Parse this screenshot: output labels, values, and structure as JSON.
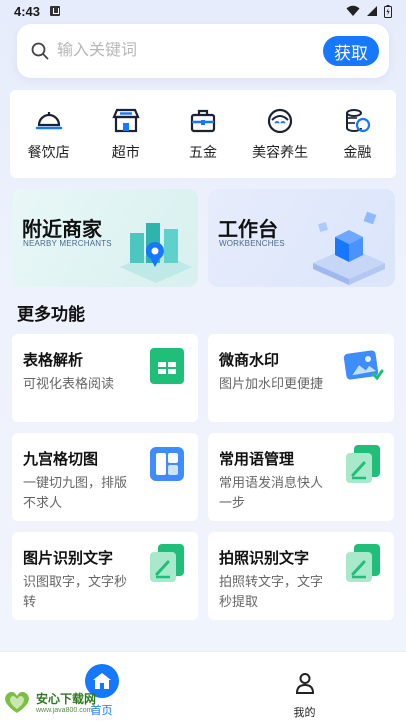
{
  "status_bar": {
    "time": "4:43"
  },
  "search": {
    "placeholder": "输入关键词",
    "button_label": "获取"
  },
  "categories": [
    {
      "label": "餐饮店",
      "icon": "restaurant-icon"
    },
    {
      "label": "超市",
      "icon": "supermarket-icon"
    },
    {
      "label": "五金",
      "icon": "hardware-icon"
    },
    {
      "label": "美容养生",
      "icon": "beauty-icon"
    },
    {
      "label": "金融",
      "icon": "finance-icon"
    }
  ],
  "banners": [
    {
      "title": "附近商家",
      "subtitle": "NEARBY MERCHANTS",
      "icon": "city-map-pin-illustration"
    },
    {
      "title": "工作台",
      "subtitle": "WORKBENCHES",
      "icon": "cubes-platform-illustration"
    }
  ],
  "section_title": "更多功能",
  "features": [
    {
      "title": "表格解析",
      "desc": "可视化表格阅读",
      "icon": "spreadsheet-icon"
    },
    {
      "title": "微商水印",
      "desc": "图片加水印更便捷",
      "icon": "watermark-image-icon"
    },
    {
      "title": "九宫格切图",
      "desc": "一键切九图，排版不求人",
      "icon": "grid-icon"
    },
    {
      "title": "常用语管理",
      "desc": "常用语发消息快人一步",
      "icon": "edit-note-icon"
    },
    {
      "title": "图片识别文字",
      "desc": "识图取字，文字秒转",
      "icon": "edit-note-icon"
    },
    {
      "title": "拍照识别文字",
      "desc": "拍照转文字，文字秒提取",
      "icon": "edit-note-icon"
    }
  ],
  "tabbar": {
    "home_label": "首页",
    "me_label": "我的"
  },
  "watermark": {
    "brand": "安心下载网",
    "url": "www.java800.com"
  },
  "colors": {
    "accent": "#1677ff",
    "green": "#1fbf7a"
  }
}
